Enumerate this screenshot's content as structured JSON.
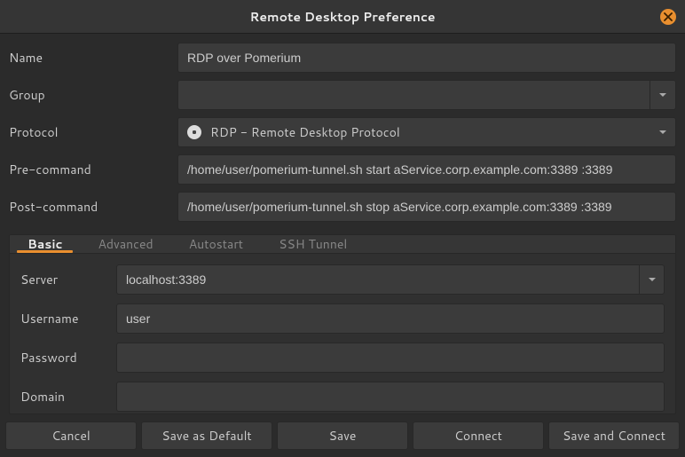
{
  "title": "Remote Desktop Preference",
  "fields": {
    "name": {
      "label": "Name",
      "value": "RDP over Pomerium"
    },
    "group": {
      "label": "Group",
      "value": ""
    },
    "protocol": {
      "label": "Protocol",
      "value": "RDP - Remote Desktop Protocol"
    },
    "precommand": {
      "label": "Pre-command",
      "value": "/home/user/pomerium-tunnel.sh start aService.corp.example.com:3389 :3389"
    },
    "postcommand": {
      "label": "Post-command",
      "value": "/home/user/pomerium-tunnel.sh stop aService.corp.example.com:3389 :3389"
    }
  },
  "tabs": [
    {
      "label": "Basic",
      "active": true
    },
    {
      "label": "Advanced",
      "active": false
    },
    {
      "label": "Autostart",
      "active": false
    },
    {
      "label": "SSH Tunnel",
      "active": false
    }
  ],
  "basic": {
    "server": {
      "label": "Server",
      "value": "localhost:3389"
    },
    "username": {
      "label": "Username",
      "value": "user"
    },
    "password": {
      "label": "Password",
      "value": ""
    },
    "domain": {
      "label": "Domain",
      "value": ""
    }
  },
  "buttons": {
    "cancel": "Cancel",
    "save_default": "Save as Default",
    "save": "Save",
    "connect": "Connect",
    "save_connect": "Save and Connect"
  }
}
